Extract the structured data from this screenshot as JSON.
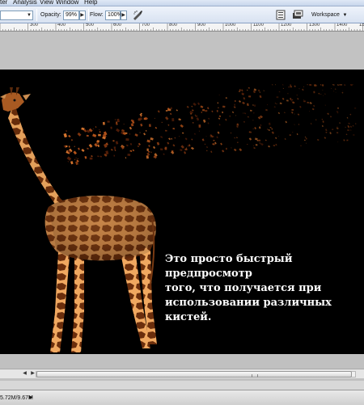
{
  "menubar": {
    "items": [
      "ter",
      "Analysis",
      "View",
      "Window",
      "Help"
    ]
  },
  "options_bar": {
    "opacity_label": "Opacity:",
    "opacity_value": "99%",
    "flow_label": "Flow:",
    "flow_value": "100%",
    "workspace_label": "Workspace"
  },
  "ruler": {
    "labels": [
      "300",
      "400",
      "500",
      "600",
      "700",
      "800",
      "900",
      "1000",
      "1100",
      "1200",
      "1300",
      "1400",
      "1500"
    ]
  },
  "canvas": {
    "overlay_text": "Это просто быстрый предпросмотр\nтого, что получается при\nиспользовании  различных кистей."
  },
  "status": {
    "doc_size": "5.72M/9.67M"
  },
  "icons": [
    "dropdown-arrow-icon",
    "airbrush-icon",
    "brush-panel-icon",
    "screen-mode-icon",
    "workspace-arrow-icon",
    "scroll-left-icon",
    "scroll-right-icon"
  ]
}
